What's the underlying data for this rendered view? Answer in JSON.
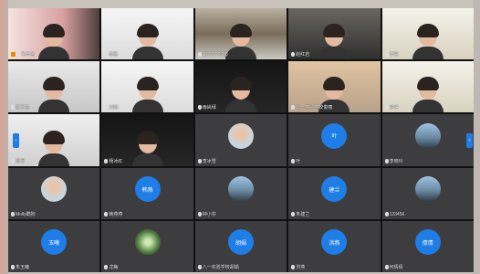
{
  "meeting": {
    "participants": [
      {
        "type": "video",
        "name": "花辛苦",
        "host": true,
        "scene": "pink"
      },
      {
        "type": "video",
        "name": "唐雅",
        "scene": "white"
      },
      {
        "type": "video",
        "name": "13?????688",
        "scene": "shelf"
      },
      {
        "type": "video",
        "name": "赵红岩",
        "scene": "office"
      },
      {
        "type": "video",
        "name": "李思",
        "scene": "bright"
      },
      {
        "type": "video",
        "name": "陈宇丽",
        "scene": "room"
      },
      {
        "type": "video",
        "name": "刘娟",
        "scene": "white"
      },
      {
        "type": "video",
        "name": "雨尚绿",
        "scene": "dark"
      },
      {
        "type": "video",
        "name": "八一实验学校俊丽",
        "scene": "bed"
      },
      {
        "type": "video",
        "name": "钟峥",
        "scene": "bright"
      },
      {
        "type": "video",
        "name": "阳明",
        "scene": "headset"
      },
      {
        "type": "video",
        "name": "杨冰红",
        "scene": "dark"
      },
      {
        "type": "avatar",
        "name": "李冰雪",
        "avatar": "portrait"
      },
      {
        "type": "avatar",
        "name": "叶",
        "avatar": "blue",
        "initial": "叶"
      },
      {
        "type": "avatar",
        "name": "李晓玲",
        "avatar": "sky"
      },
      {
        "type": "avatar",
        "name": "Molly酷狗",
        "avatar": "portrait"
      },
      {
        "type": "avatar",
        "name": "韩燕燕",
        "avatar": "blue",
        "initial": "韩燕"
      },
      {
        "type": "avatar",
        "name": "钟小芬",
        "avatar": "sky"
      },
      {
        "type": "avatar",
        "name": "朱建兰",
        "avatar": "blue",
        "initial": "建兰"
      },
      {
        "type": "avatar",
        "name": "123456",
        "avatar": "sky"
      },
      {
        "type": "avatar",
        "name": "朱玉曦",
        "avatar": "blue",
        "initial": "玉曦"
      },
      {
        "type": "avatar",
        "name": "龙梅",
        "avatar": "flower"
      },
      {
        "type": "avatar",
        "name": "八一实验学校胡娟",
        "avatar": "blue",
        "initial": "胡娟"
      },
      {
        "type": "avatar",
        "name": "洪燕",
        "avatar": "blue",
        "initial": "洪燕"
      },
      {
        "type": "avatar",
        "name": "何倩倩",
        "avatar": "blue",
        "initial": "倩倩"
      }
    ]
  },
  "nav": {
    "prev": "‹",
    "next": "›"
  },
  "colors": {
    "accent": "#1e7de6",
    "host": "#f08a00"
  }
}
